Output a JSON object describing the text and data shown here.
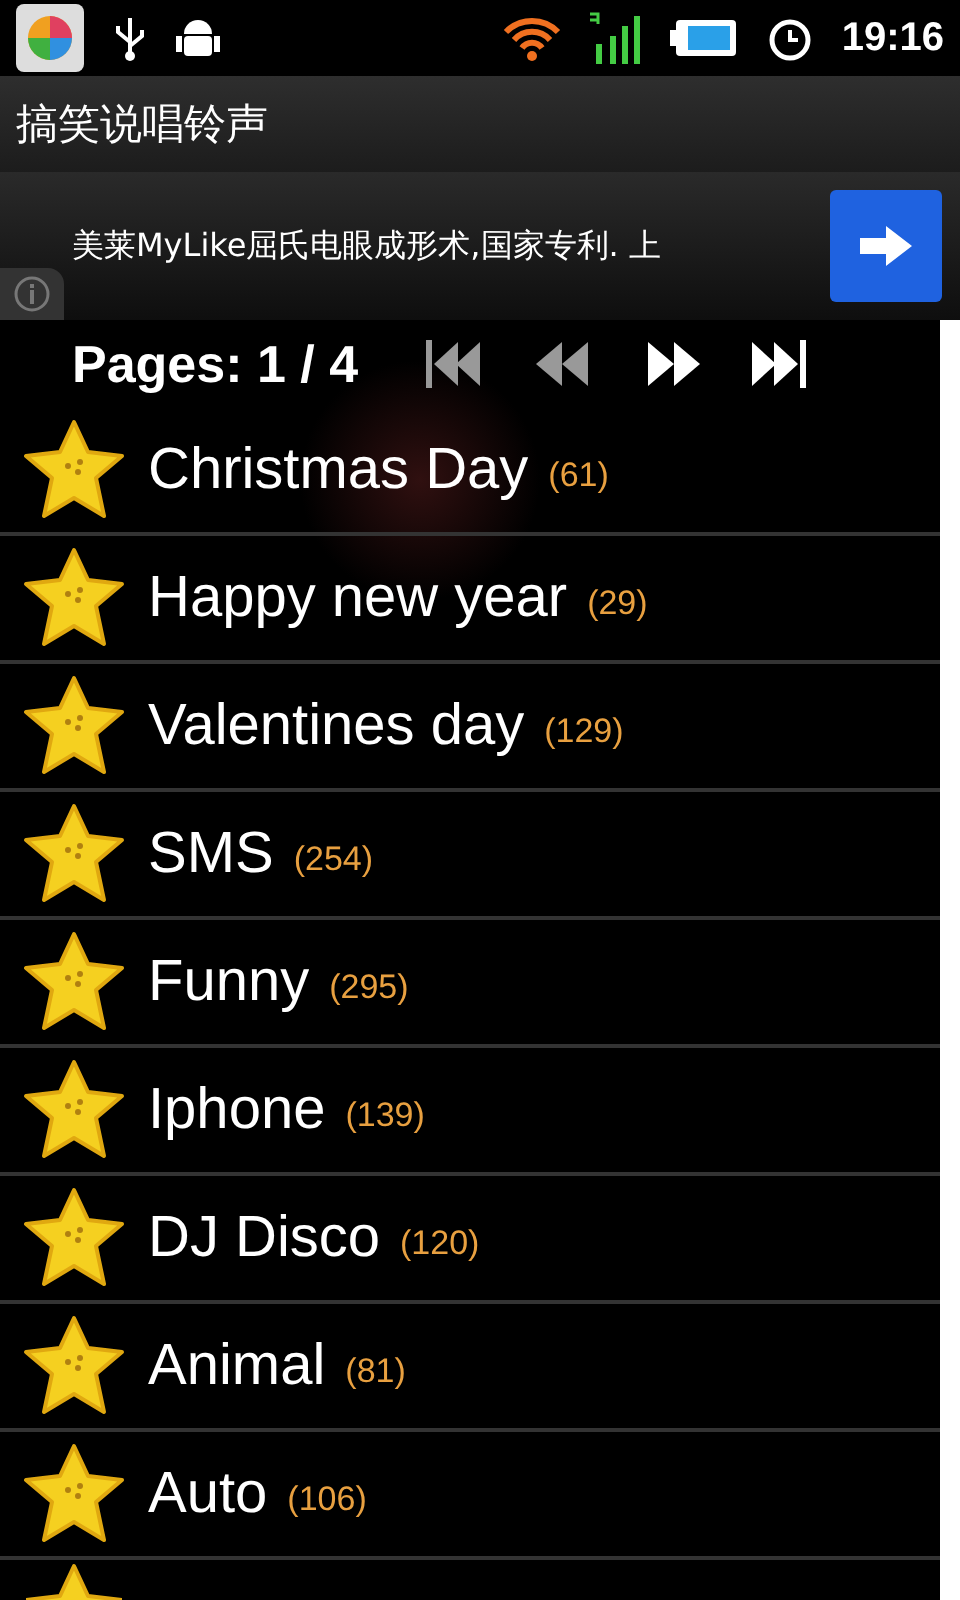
{
  "status_bar": {
    "time": "19:16"
  },
  "title": "搞笑说唱铃声",
  "ad": {
    "text": "美莱MyLike屈氏电眼成形术,国家专利. 上"
  },
  "pager": {
    "label": "Pages: 1 / 4",
    "buttons": [
      {
        "kind": "first",
        "disabled": true
      },
      {
        "kind": "prev",
        "disabled": true
      },
      {
        "kind": "next",
        "disabled": false
      },
      {
        "kind": "last",
        "disabled": false
      }
    ]
  },
  "categories": [
    {
      "name": "Christmas Day",
      "count": "(61)"
    },
    {
      "name": "Happy new year",
      "count": "(29)"
    },
    {
      "name": "Valentines day",
      "count": "(129)"
    },
    {
      "name": "SMS",
      "count": "(254)"
    },
    {
      "name": "Funny",
      "count": "(295)"
    },
    {
      "name": "Iphone",
      "count": "(139)"
    },
    {
      "name": "DJ Disco",
      "count": "(120)"
    },
    {
      "name": "Animal",
      "count": "(81)"
    },
    {
      "name": "Auto",
      "count": "(106)"
    }
  ]
}
